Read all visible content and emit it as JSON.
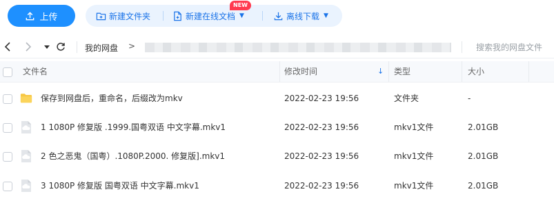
{
  "toolbar": {
    "upload_label": "上传",
    "new_folder_label": "新建文件夹",
    "new_online_doc_label": "新建在线文档",
    "new_badge": "NEW",
    "offline_download_label": "离线下载"
  },
  "nav": {
    "breadcrumb_root": "我的网盘",
    "breadcrumb_separator": ">",
    "search_placeholder": "搜索我的网盘文件"
  },
  "table": {
    "headers": {
      "name": "文件名",
      "modified": "修改时间",
      "type": "类型",
      "size": "大小"
    },
    "sort_indicator": "↓",
    "rows": [
      {
        "icon": "folder-icon",
        "name": "保存到网盘后，重命名，后缀改为mkv",
        "modified": "2022-02-23 19:56",
        "type": "文件夹",
        "size": "-"
      },
      {
        "icon": "file-icon",
        "name": "1 1080P 修复版 .1999.国粤双语  中文字幕.mkv1",
        "modified": "2022-02-23 19:56",
        "type": "mkv1文件",
        "size": "2.01GB"
      },
      {
        "icon": "file-icon",
        "name": "2 色之恶鬼（国粤）.1080P.2000. 修复版].mkv1",
        "modified": "2022-02-23 19:56",
        "type": "mkv1文件",
        "size": "2.01GB"
      },
      {
        "icon": "file-icon",
        "name": "3 1080P 修复版 国粤双语  中文字幕.mkv1",
        "modified": "2022-02-23 19:56",
        "type": "mkv1文件",
        "size": "2.01GB"
      }
    ]
  },
  "colors": {
    "accent": "#1e90ff",
    "toolbar_bg": "#eaf3fe",
    "folder": "#f7c744",
    "badge": "#ff3a4f"
  }
}
